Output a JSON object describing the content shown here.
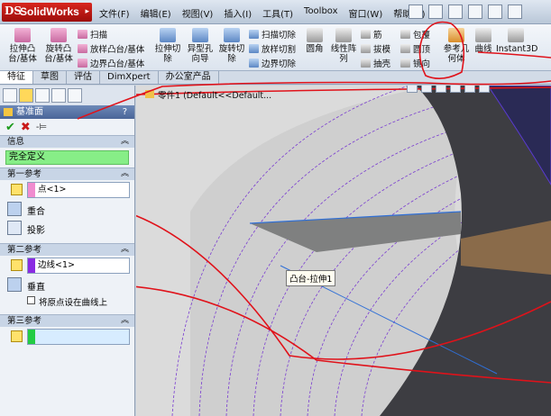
{
  "app": {
    "logo_prefix": "DS",
    "logo_name": "SolidWorks",
    "logo_arrow": "▸"
  },
  "menu": [
    "文件(F)",
    "编辑(E)",
    "视图(V)",
    "插入(I)",
    "工具(T)",
    "Toolbox",
    "窗口(W)",
    "帮助(H)"
  ],
  "ribbon": {
    "extrude_boss": "拉伸凸\n台/基体",
    "revolve_boss": "旋转凸\n台/基体",
    "sweep": "扫描",
    "loft": "放样凸台/基体",
    "boundary_boss": "边界凸台/基体",
    "extrude_cut": "拉伸切\n除",
    "hole_wizard": "异型孔\n向导",
    "revolve_cut": "旋转切\n除",
    "swept_cut": "扫描切除",
    "lofted_cut": "放样切割",
    "boundary_cut": "边界切除",
    "fillet": "圆角",
    "linear_pattern": "线性阵\n列",
    "rib": "筋",
    "draft": "拔模",
    "shell": "抽壳",
    "wrap": "包覆",
    "dome": "圆顶",
    "mirror": "镜向",
    "ref_geometry": "参考几\n何体",
    "curves": "曲线",
    "instant3d": "Instant3D"
  },
  "tabs": [
    {
      "label": "特征",
      "active": true
    },
    {
      "label": "草图",
      "active": false
    },
    {
      "label": "评估",
      "active": false
    },
    {
      "label": "DimXpert",
      "active": false
    },
    {
      "label": "办公室产品",
      "active": false
    }
  ],
  "panel": {
    "title": "基准面",
    "help": "?",
    "ok": "✔",
    "cancel": "✖",
    "pin": "-⊨",
    "info_title": "信息",
    "info_status": "完全定义",
    "first_ref_title": "第一参考",
    "first_ref_value": "点<1>",
    "first_ref_color": "#f08ccf",
    "opt_coincident": "重合",
    "opt_project": "投影",
    "second_ref_title": "第二参考",
    "second_ref_value": "边线<1>",
    "second_ref_color": "#8a2be2",
    "opt_perpendicular": "垂直",
    "chk_origin_on_curve": "将原点设在曲线上",
    "third_ref_title": "第三参考",
    "third_ref_value": "",
    "third_ref_color": "#22cc44",
    "chevron": "︽"
  },
  "view": {
    "tree_label": "零件1  (Default<<Default...",
    "tooltip": "凸台-拉伸1"
  }
}
